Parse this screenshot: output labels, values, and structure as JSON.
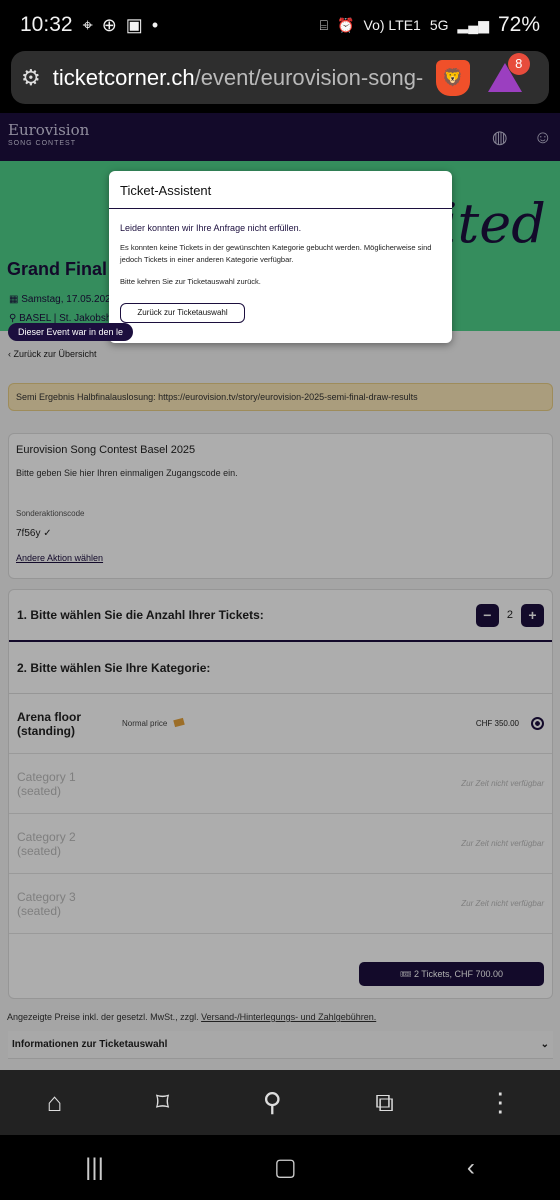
{
  "status": {
    "time": "10:32",
    "network": "Vo) LTE1",
    "network_type": "5G",
    "battery": "72%"
  },
  "browser": {
    "url_domain": "ticketcorner.ch",
    "url_path": "/event/eurovision-song-",
    "rewards_badge": "8"
  },
  "site": {
    "logo": "Eurovision",
    "logo_sub": "SONG CONTEST"
  },
  "event": {
    "title": "Grand Final L",
    "date": "Samstag, 17.05.202",
    "location": "BASEL | St. Jakobsh",
    "hero_text": "United",
    "hero_text2": "ic",
    "past_badge": "Dieser Event war in den le",
    "back_link": "Zurück zur Übersicht"
  },
  "notice": "Semi Ergebnis Halbfinalauslosung: https://eurovision.tv/story/eurovision-2025-semi-final-draw-results",
  "access": {
    "title": "Eurovision Song Contest Basel 2025",
    "prompt": "Bitte geben Sie hier Ihren einmaligen Zugangscode ein.",
    "code_label": "Sonderaktionscode",
    "code": "7f56y",
    "change_link": "Andere Aktion wählen"
  },
  "selection": {
    "step1": "1. Bitte wählen Sie die Anzahl Ihrer Tickets:",
    "quantity": "2",
    "minus": "−",
    "plus": "+",
    "step2": "2. Bitte wählen Sie Ihre Kategorie:",
    "categories": [
      {
        "name": "Arena floor (standing)",
        "price_type": "Normal price",
        "price": "CHF 350.00"
      },
      {
        "name": "Category 1 (seated)",
        "status": "Zur Zeit nicht verfügbar"
      },
      {
        "name": "Category 2 (seated)",
        "status": "Zur Zeit nicht verfügbar"
      },
      {
        "name": "Category 3 (seated)",
        "status": "Zur Zeit nicht verfügbar"
      }
    ],
    "total_button": "2 Tickets, CHF 700.00"
  },
  "footer_note": {
    "text": "Angezeigte Preise inkl. der gesetzl. MwSt., zzgl.",
    "link": "Versand-/Hinterlegungs- und Zahlgebühren."
  },
  "info_section": "Informationen zur Ticketauswahl",
  "modal": {
    "title": "Ticket-Assistent",
    "message": "Leider konnten wir Ihre Anfrage nicht erfüllen.",
    "detail": "Es konnten keine Tickets in der gewünschten Kategorie gebucht werden. Möglicherweise sind jedoch Tickets in einer anderen Kategorie verfügbar.",
    "instruction": "Bitte kehren Sie zur Ticketauswahl zurück.",
    "button": "Zurück zur Ticketauswahl"
  },
  "colors": {
    "brand": "#1c0f3e",
    "hero": "#4fd08a",
    "notice": "#fbe7b8"
  },
  "icons": [
    "location-icon",
    "add-icon",
    "image-icon",
    "alarm-icon",
    "tune-icon",
    "brave-lion-icon",
    "rewards-icon",
    "globe-icon",
    "user-icon",
    "calendar-icon",
    "pin-icon",
    "ticket-icon",
    "home-icon",
    "bookmark-icon",
    "search-icon",
    "tabs-icon",
    "menu-icon",
    "recents-icon",
    "home-nav-icon",
    "back-nav-icon"
  ]
}
